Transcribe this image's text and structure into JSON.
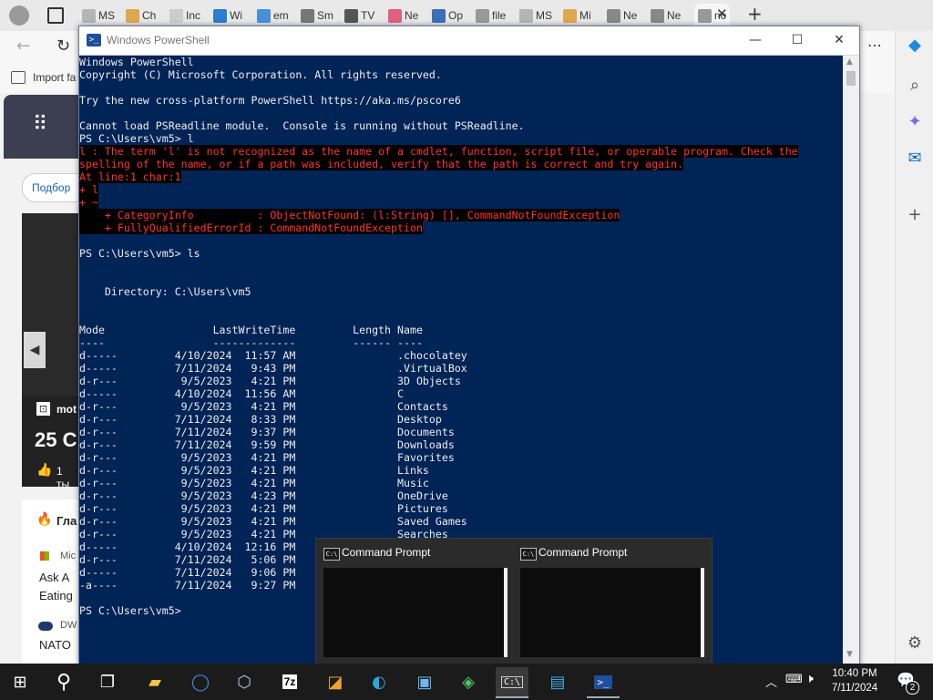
{
  "browser": {
    "tabs": [
      "MS",
      "Ch",
      "Inc",
      "Wi",
      "em",
      "Sm",
      "TV",
      "Ne",
      "Op",
      "file",
      "MS",
      "Mi",
      "Ne",
      "Ne",
      "no"
    ],
    "favorites_item": "Import fa",
    "page_fragments": {
      "search_button": "Подбор",
      "card_source": "mot",
      "card_headline": "25 C",
      "card_likes": "1 ты",
      "news_item_1": "Гла",
      "news_source": "Mic",
      "news_line_1": "Ask A",
      "news_line_2": "Eating",
      "news_source_2": "DW",
      "news_line_3": "NATO"
    }
  },
  "powershell": {
    "title": "Windows PowerShell",
    "icon_text": ">_",
    "lines": [
      {
        "t": "Windows PowerShell",
        "e": false
      },
      {
        "t": "Copyright (C) Microsoft Corporation. All rights reserved.",
        "e": false
      },
      {
        "t": "",
        "e": false
      },
      {
        "t": "Try the new cross-platform PowerShell https://aka.ms/pscore6",
        "e": false
      },
      {
        "t": "",
        "e": false
      },
      {
        "t": "Cannot load PSReadline module.  Console is running without PSReadline.",
        "e": false
      },
      {
        "t": "PS C:\\Users\\vm5> l",
        "e": false
      },
      {
        "t": "l : The term 'l' is not recognized as the name of a cmdlet, function, script file, or operable program. Check the",
        "e": true
      },
      {
        "t": "spelling of the name, or if a path was included, verify that the path is correct and try again.",
        "e": true
      },
      {
        "t": "At line:1 char:1",
        "e": true
      },
      {
        "t": "+ l",
        "e": true
      },
      {
        "t": "+ ~",
        "e": true
      },
      {
        "t": "    + CategoryInfo          : ObjectNotFound: (l:String) [], CommandNotFoundException",
        "e": true
      },
      {
        "t": "    + FullyQualifiedErrorId : CommandNotFoundException",
        "e": true
      },
      {
        "t": "",
        "e": false
      },
      {
        "t": "PS C:\\Users\\vm5> ls",
        "e": false
      },
      {
        "t": "",
        "e": false
      },
      {
        "t": "",
        "e": false
      },
      {
        "t": "    Directory: C:\\Users\\vm5",
        "e": false
      },
      {
        "t": "",
        "e": false
      },
      {
        "t": "",
        "e": false
      },
      {
        "t": "Mode                 LastWriteTime         Length Name",
        "e": false
      },
      {
        "t": "----                 -------------         ------ ----",
        "e": false
      },
      {
        "t": "d-----         4/10/2024  11:57 AM                .chocolatey",
        "e": false
      },
      {
        "t": "d-----         7/11/2024   9:43 PM                .VirtualBox",
        "e": false
      },
      {
        "t": "d-r---          9/5/2023   4:21 PM                3D Objects",
        "e": false
      },
      {
        "t": "d-----         4/10/2024  11:56 AM                C",
        "e": false
      },
      {
        "t": "d-r---          9/5/2023   4:21 PM                Contacts",
        "e": false
      },
      {
        "t": "d-r---         7/11/2024   8:33 PM                Desktop",
        "e": false
      },
      {
        "t": "d-r---         7/11/2024   9:37 PM                Documents",
        "e": false
      },
      {
        "t": "d-r---         7/11/2024   9:59 PM                Downloads",
        "e": false
      },
      {
        "t": "d-r---          9/5/2023   4:21 PM                Favorites",
        "e": false
      },
      {
        "t": "d-r---          9/5/2023   4:21 PM                Links",
        "e": false
      },
      {
        "t": "d-r---          9/5/2023   4:21 PM                Music",
        "e": false
      },
      {
        "t": "d-r---          9/5/2023   4:23 PM                OneDrive",
        "e": false
      },
      {
        "t": "d-r---          9/5/2023   4:21 PM                Pictures",
        "e": false
      },
      {
        "t": "d-r---          9/5/2023   4:21 PM                Saved Games",
        "e": false
      },
      {
        "t": "d-r---          9/5/2023   4:21 PM                Searches",
        "e": false
      },
      {
        "t": "d-----         4/10/2024  12:16 PM",
        "e": false
      },
      {
        "t": "d-r---         7/11/2024   5:06 PM",
        "e": false
      },
      {
        "t": "d-----         7/11/2024   9:06 PM",
        "e": false
      },
      {
        "t": "-a----         7/11/2024   9:27 PM",
        "e": false
      },
      {
        "t": "",
        "e": false
      },
      {
        "t": "PS C:\\Users\\vm5>",
        "e": false
      }
    ]
  },
  "thumbnails": [
    {
      "title": "Command Prompt"
    },
    {
      "title": "Command Prompt"
    }
  ],
  "taskbar": {
    "time": "10:40 PM",
    "date": "7/11/2024",
    "notification_count": "2",
    "apps": [
      "start-icon",
      "search-icon",
      "task-view-icon",
      "file-explorer-icon",
      "app-blue-circle-icon",
      "virtualbox-icon",
      "7zip-icon",
      "app-orange-icon",
      "edge-icon",
      "control-panel-icon",
      "app-network-icon",
      "command-prompt-icon",
      "remote-desktop-icon",
      "powershell-icon"
    ],
    "app_7z_label": "7z"
  }
}
